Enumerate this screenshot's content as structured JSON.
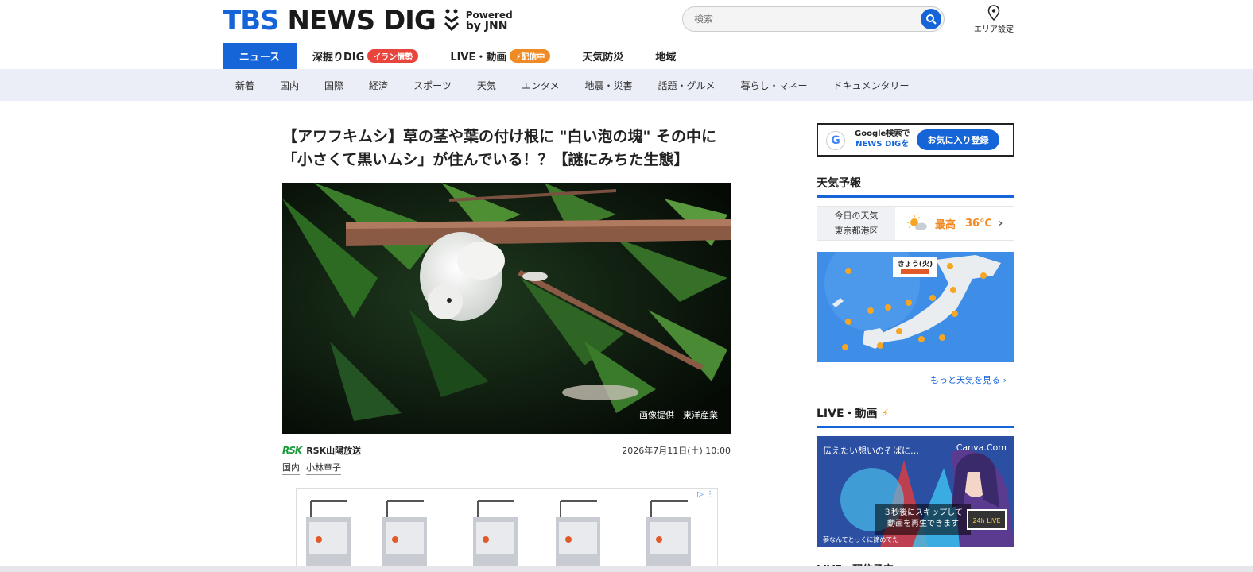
{
  "header": {
    "logo_tbs": "TBS",
    "logo_rest": "NEWS DIG",
    "powered_line1": "Powered",
    "powered_line2": "by JNN",
    "search_placeholder": "検索",
    "area_label": "エリア設定"
  },
  "main_nav": [
    {
      "label": "ニュース",
      "badge": ""
    },
    {
      "label": "深掘りDIG",
      "badge": "イラン情勢"
    },
    {
      "label": "LIVE・動画",
      "badge": "配信中"
    },
    {
      "label": "天気防災",
      "badge": ""
    },
    {
      "label": "地域",
      "badge": ""
    }
  ],
  "sub_nav": [
    "新着",
    "国内",
    "国際",
    "経済",
    "スポーツ",
    "天気",
    "エンタメ",
    "地震・災害",
    "話題・グルメ",
    "暮らし・マネー",
    "ドキュメンタリー"
  ],
  "article": {
    "headline": "【アワフキムシ】草の茎や葉の付け根に \"白い泡の塊\" その中に「小さくて黒いムシ」が住んでいる！？【謎にみちた生態】",
    "photo_credit": "画像提供　東洋産業",
    "source_logo": "RSK",
    "source_name": "RSK山陽放送",
    "date": "2026年7月11日(土) 10:00",
    "tags": [
      "国内",
      "小林章子"
    ]
  },
  "sidebar": {
    "fav_line1": "Google検索で",
    "fav_line2": "NEWS DIGを",
    "fav_button": "お気に入り登録",
    "weather_title": "天気予報",
    "weather_today": "今日の天気",
    "weather_place": "東京都港区",
    "weather_high_label": "最高",
    "weather_high_value": "36℃",
    "map_header": "きょう(火)",
    "more_weather": "もっと天気を見る ›",
    "live_title": "LIVE・動画",
    "video_text_left": "伝えたい想いのそばに…",
    "video_text_right": "Canva.Com",
    "video_skip_line1": "３秒後にスキップして",
    "video_skip_line2": "動画を再生できます",
    "video_live_badge": "24h LIVE",
    "video_bottom": "夢なんてとっくに諦めてた",
    "next_section": "LIVE・配信予定"
  },
  "colors": {
    "brand_blue": "#1565d8",
    "badge_red": "#e8453c",
    "badge_orange": "#f08a24",
    "subnav_bg": "#ebeef6"
  }
}
